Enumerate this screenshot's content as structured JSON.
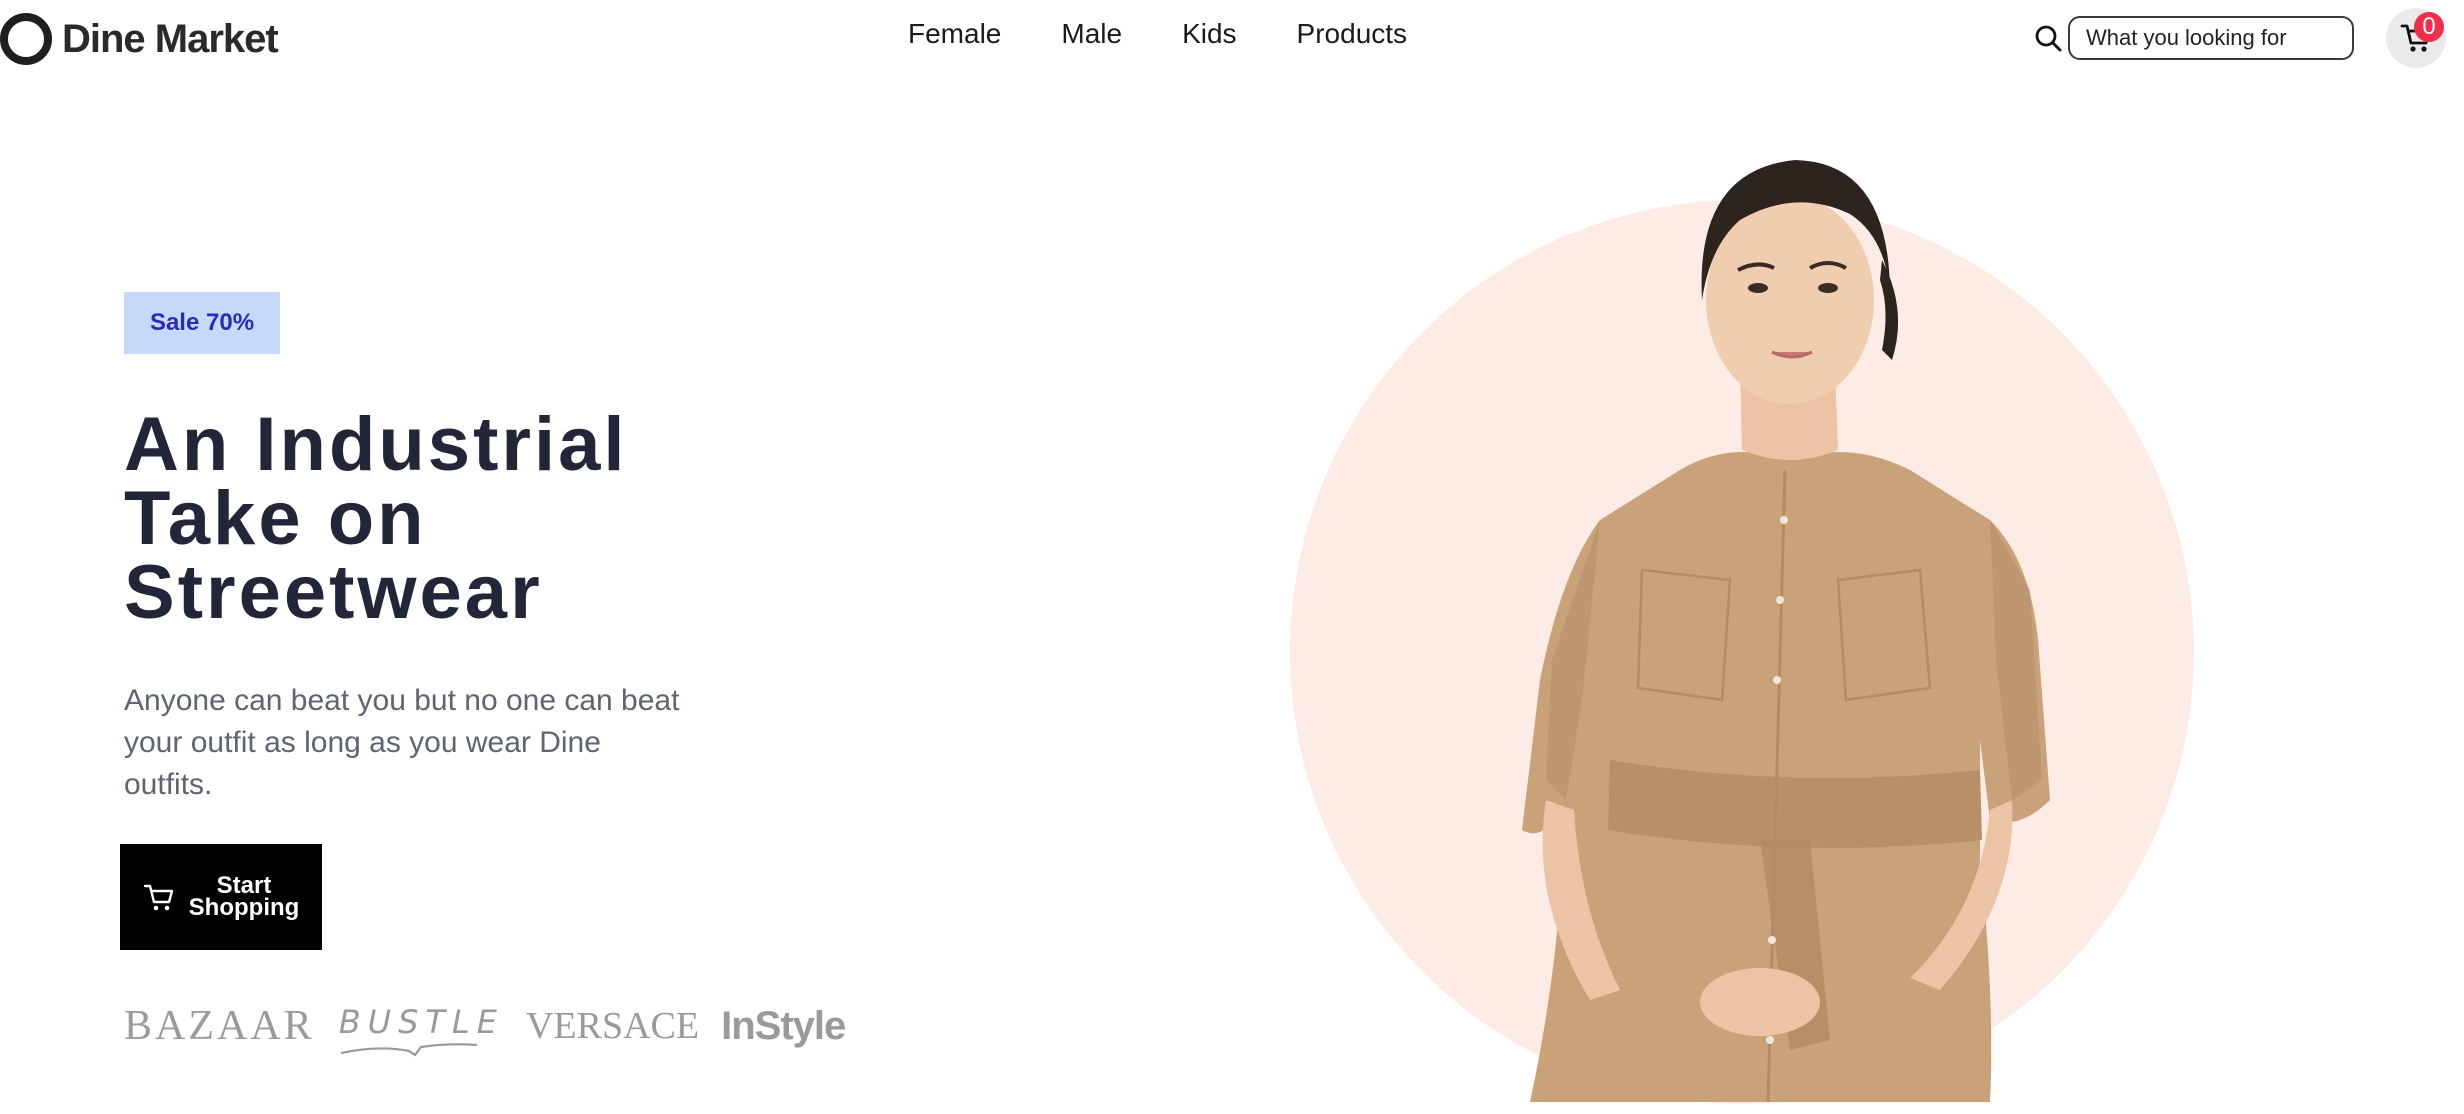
{
  "brand": {
    "name": "Dine Market"
  },
  "nav": {
    "links": [
      "Female",
      "Male",
      "Kids",
      "Products"
    ]
  },
  "search": {
    "placeholder": "What you looking for"
  },
  "cart": {
    "count": "0"
  },
  "hero": {
    "badge": "Sale 70%",
    "title_lines": [
      "An Industrial",
      "Take on",
      "Streetwear"
    ],
    "description": "Anyone can beat you but no one can beat your outfit as long as you wear Dine outfits.",
    "cta_line1": "Start",
    "cta_line2": "Shopping",
    "image_alt": "model-in-tan-shirt-dress"
  },
  "brands": [
    "BAZAAR",
    "BUSTLE",
    "VERSACE",
    "InStyle"
  ],
  "colors": {
    "badge_bg": "#c5d9fb",
    "badge_text": "#2c2bb7",
    "title": "#212738",
    "circle": "#fdebe5",
    "cta_bg": "#000000",
    "cart_badge": "#f02d4b"
  }
}
